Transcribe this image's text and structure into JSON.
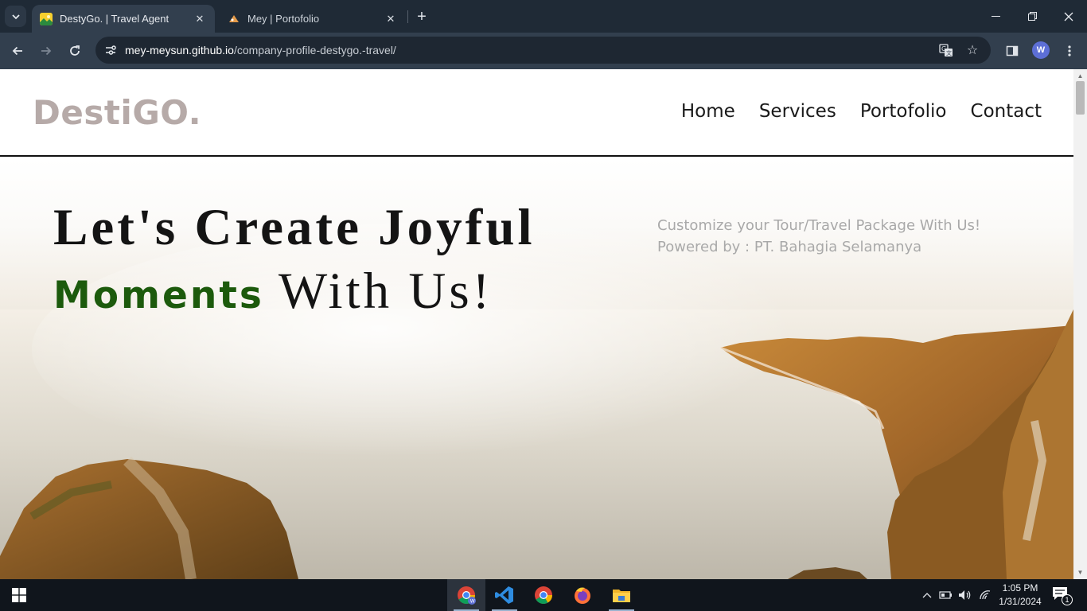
{
  "browser": {
    "tabs": [
      {
        "title": "DestyGo. | Travel Agent",
        "active": true,
        "favicon": "destygo-favicon"
      },
      {
        "title": "Mey | Portofolio",
        "active": false,
        "favicon": "mey-favicon"
      }
    ],
    "url": {
      "host": "mey-meysun.github.io",
      "path": "/company-profile-destygo.-travel/"
    },
    "profile_initial": "W"
  },
  "site": {
    "logo": "DestiGO.",
    "nav": [
      "Home",
      "Services",
      "Portofolio",
      "Contact"
    ],
    "hero": {
      "line1": "Let's Create Joyful",
      "accent": "Moments",
      "line2_rest": "With Us!",
      "tagline1": "Customize your Tour/Travel Package With Us!",
      "tagline2": "Powered by : PT. Bahagia Selamanya"
    }
  },
  "taskbar": {
    "apps": [
      "chrome-profile",
      "vscode",
      "chrome",
      "firefox",
      "file-explorer"
    ],
    "time": "1:05 PM",
    "date": "1/31/2024",
    "notification_count": "1"
  },
  "colors": {
    "accent_green": "#1c5a0c",
    "logo_gray": "#b6aaa8",
    "chrome_dark": "#1f2a36",
    "toolbar": "#323f4e"
  }
}
